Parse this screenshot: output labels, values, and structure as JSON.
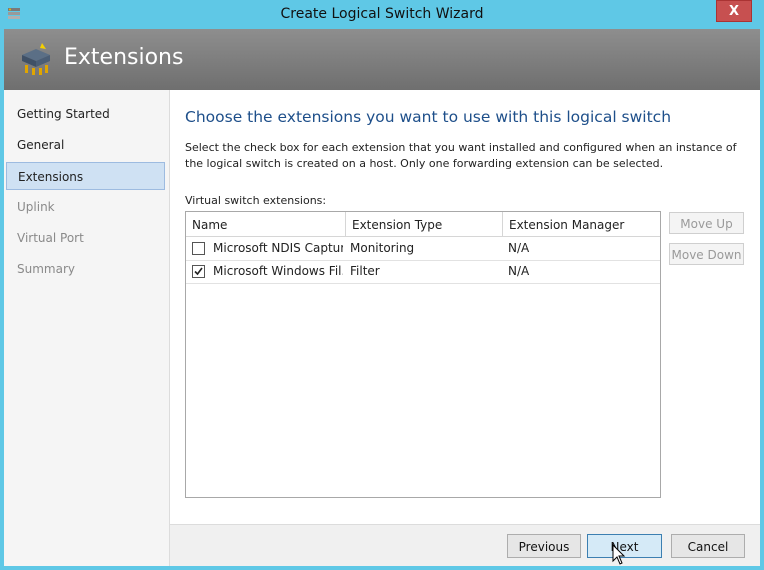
{
  "window": {
    "title": "Create Logical Switch Wizard",
    "close_label": "X"
  },
  "header": {
    "title": "Extensions"
  },
  "nav": {
    "items": [
      {
        "label": "Getting Started",
        "state": "normal"
      },
      {
        "label": "General",
        "state": "normal"
      },
      {
        "label": "Extensions",
        "state": "selected"
      },
      {
        "label": "Uplink",
        "state": "disabled"
      },
      {
        "label": "Virtual Port",
        "state": "disabled"
      },
      {
        "label": "Summary",
        "state": "disabled"
      }
    ]
  },
  "main": {
    "title": "Choose the extensions you want to use with this logical switch",
    "description": "Select the check box for each extension that you want installed and configured when an instance of the logical switch is created on a host. Only one forwarding extension can be selected.",
    "list_label": "Virtual switch extensions:",
    "columns": [
      "Name",
      "Extension Type",
      "Extension Manager"
    ],
    "rows": [
      {
        "checked": false,
        "name": "Microsoft NDIS Capture",
        "type": "Monitoring",
        "manager": "N/A"
      },
      {
        "checked": true,
        "name": "Microsoft Windows Fil...",
        "type": "Filter",
        "manager": "N/A"
      }
    ],
    "move_up_label": "Move Up",
    "move_down_label": "Move Down"
  },
  "footer": {
    "previous_label": "Previous",
    "next_label": "Next",
    "cancel_label": "Cancel"
  },
  "colors": {
    "frame": "#5fc8e6",
    "title_accent": "#1e4f8a",
    "selected_nav": "#cfe1f3",
    "close": "#c75050"
  }
}
